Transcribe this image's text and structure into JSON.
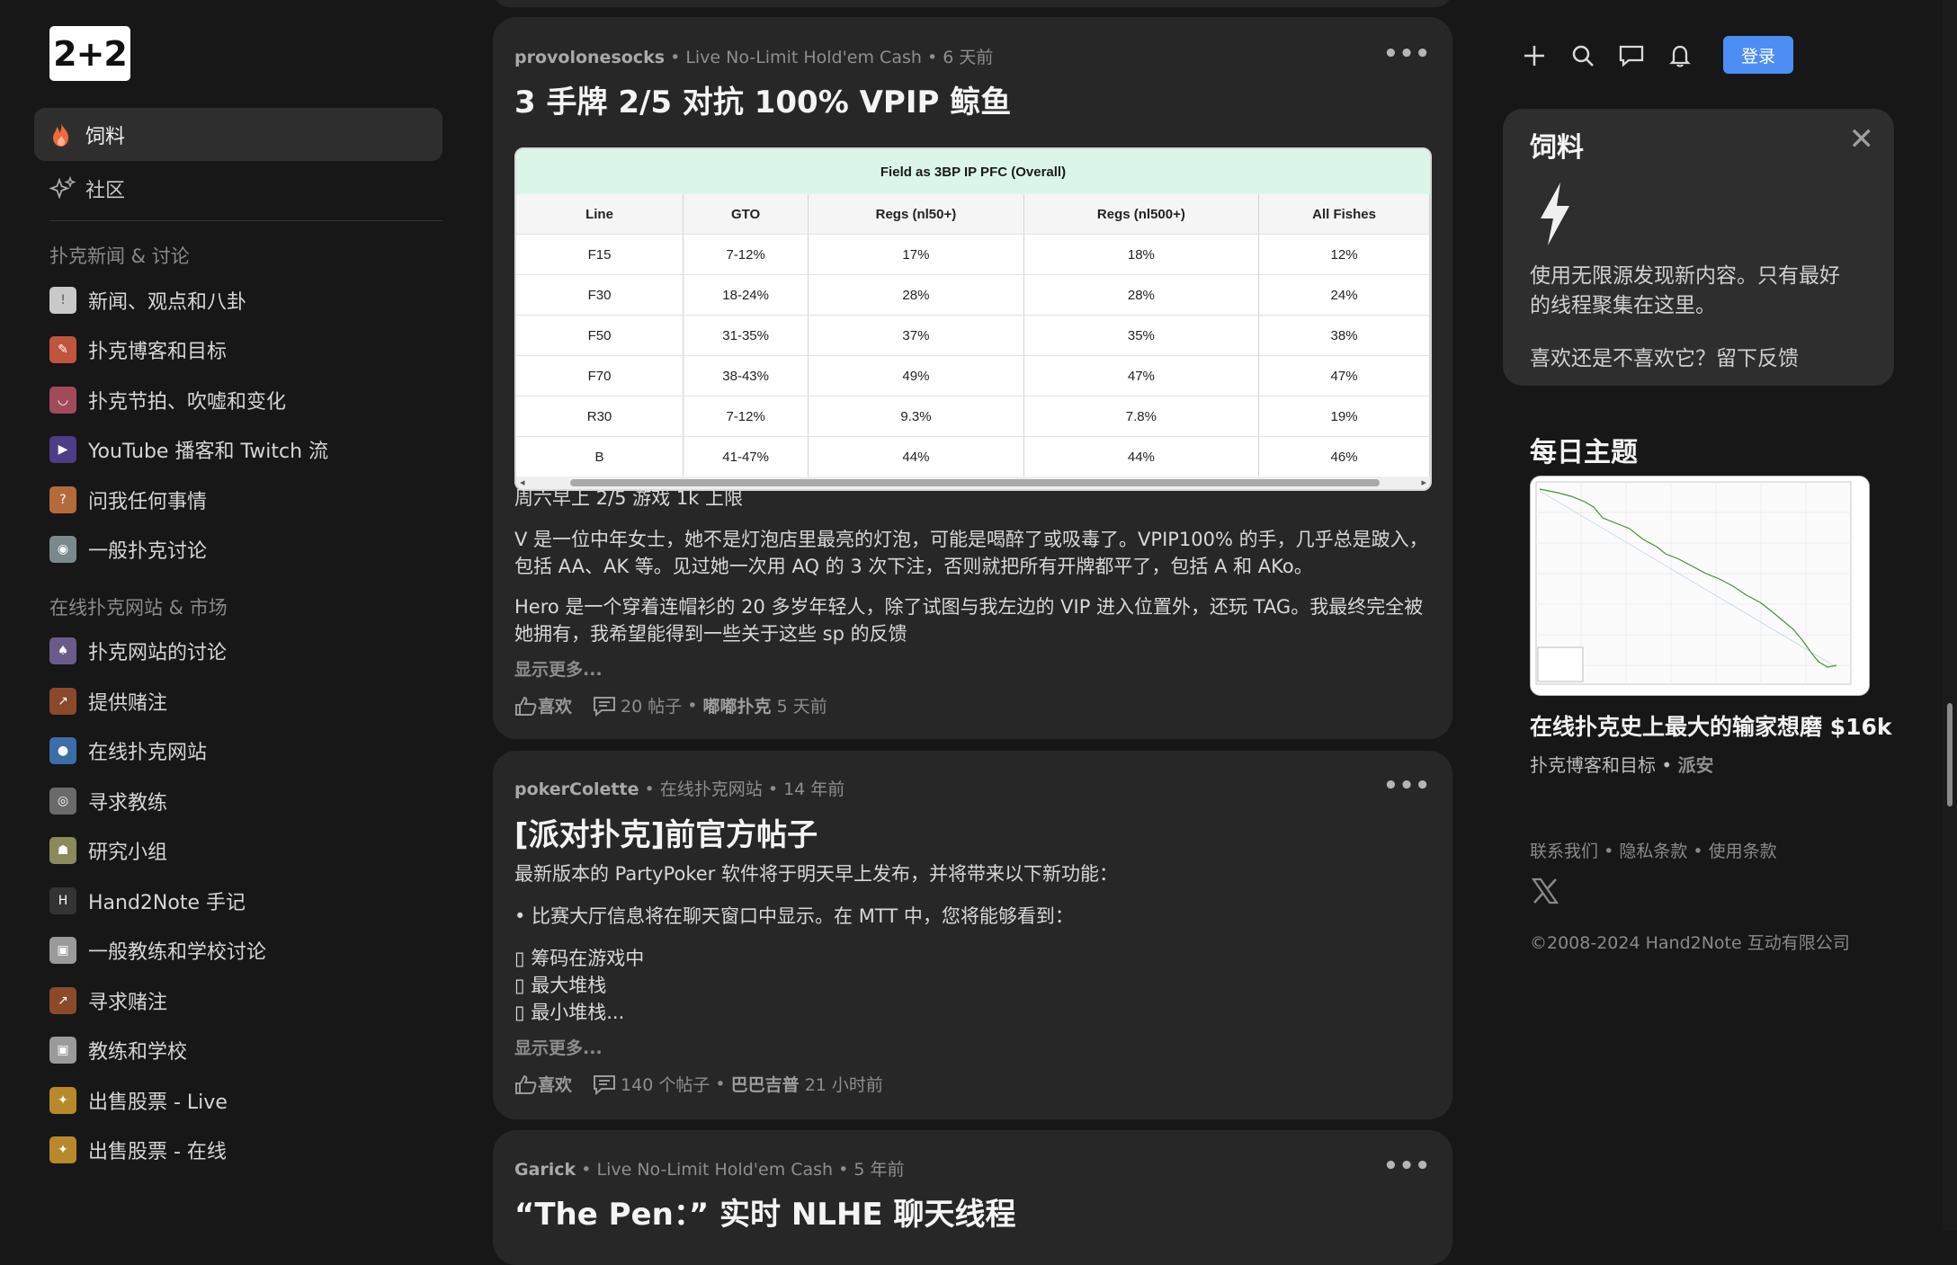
{
  "sidebar": {
    "logo": "2+2",
    "nav": [
      {
        "label": "饲料",
        "icon": "flame-icon",
        "active": true
      },
      {
        "label": "社区",
        "icon": "sparkle-icon",
        "active": false
      }
    ],
    "section1": {
      "heading": "扑克新闻 & 讨论",
      "items": [
        {
          "label": "新闻、观点和八卦",
          "color": "#c9c9c9"
        },
        {
          "label": "扑克博客和目标",
          "color": "#c0553d"
        },
        {
          "label": "扑克节拍、吹嘘和变化",
          "color": "#a14b5a"
        },
        {
          "label": "YouTube 播客和 Twitch 流",
          "color": "#4b3d86"
        },
        {
          "label": "问我任何事情",
          "color": "#b56a3a"
        },
        {
          "label": "一般扑克讨论",
          "color": "#7a8a8c"
        }
      ]
    },
    "section2": {
      "heading": "在线扑克网站 & 市场",
      "items": [
        {
          "label": "扑克网站的讨论",
          "color": "#6b5b8a"
        },
        {
          "label": "提供赌注",
          "color": "#8a4a2a"
        },
        {
          "label": "在线扑克网站",
          "color": "#3b6ea8"
        },
        {
          "label": "寻求教练",
          "color": "#6a6a6a"
        },
        {
          "label": "研究小组",
          "color": "#8a8a5a"
        },
        {
          "label": "Hand2Note 手记",
          "color": "#333333"
        },
        {
          "label": "一般教练和学校讨论",
          "color": "#9a9a9a"
        },
        {
          "label": "寻求赌注",
          "color": "#8a4a2a"
        },
        {
          "label": "教练和学校",
          "color": "#9a9a9a"
        },
        {
          "label": "出售股票 - Live",
          "color": "#b8892a"
        },
        {
          "label": "出售股票 - 在线",
          "color": "#b8892a"
        }
      ]
    }
  },
  "feed": {
    "posts": [
      {
        "author": "provolonesocks",
        "category": "Live No-Limit Hold'em Cash",
        "age": "6 天前",
        "title": "3 手牌 2/5 对抗 100% VPIP 鲸鱼",
        "table": {
          "caption": "Field as 3BP IP PFC (Overall)",
          "headers": [
            "Line",
            "GTO",
            "Regs (nl50+)",
            "Regs (nl500+)",
            "All Fishes"
          ],
          "rows": [
            [
              "F15",
              "7-12%",
              "17%",
              "18%",
              "12%"
            ],
            [
              "F30",
              "18-24%",
              "28%",
              "28%",
              "24%"
            ],
            [
              "F50",
              "31-35%",
              "37%",
              "35%",
              "38%"
            ],
            [
              "F70",
              "38-43%",
              "49%",
              "47%",
              "47%"
            ],
            [
              "R30",
              "7-12%",
              "9.3%",
              "7.8%",
              "19%"
            ],
            [
              "B",
              "41-47%",
              "44%",
              "44%",
              "46%"
            ]
          ]
        },
        "body": [
          "周六早上 2/5 游戏 1k 上限",
          "V 是一位中年女士，她不是灯泡店里最亮的灯泡，可能是喝醉了或吸毒了。VPIP100% 的手，几乎总是跛入，包括 AA、AK 等。见过她一次用 AQ 的 3 次下注，否则就把所有开牌都平了，包括 A 和 AKo。",
          "Hero 是一个穿着连帽衫的 20 多岁年轻人，除了试图与我左边的 VIP 进入位置外，还玩 TAG。我最终完全被她拥有，我希望能得到一些关于这些 sp 的反馈"
        ],
        "more": "显示更多...",
        "like": "喜欢",
        "replies": "20 帖子",
        "last_user": "嘟嘟扑克",
        "last_age": "5 天前"
      },
      {
        "author": "pokerColette",
        "category": "在线扑克网站",
        "age": "14 年前",
        "title": "[派对扑克]前官方帖子",
        "body": [
          "最新版本的 PartyPoker 软件将于明天早上发布，并将带来以下新功能：",
          "• 比赛大厅信息将在聊天窗口中显示。在 MTT 中，您将能够看到：",
          "▯ 筹码在游戏中",
          "▯ 最大堆栈",
          "▯ 最小堆栈..."
        ],
        "more": "显示更多...",
        "like": "喜欢",
        "replies": "140 个帖子",
        "last_user": "巴巴吉普",
        "last_age": "21 小时前"
      },
      {
        "author": "Garick",
        "category": "Live No-Limit Hold'em Cash",
        "age": "5 年前",
        "title": "“The Pen：” 实时 NLHE 聊天线程"
      }
    ]
  },
  "topbar": {
    "login": "登录"
  },
  "promo": {
    "title": "饲料",
    "text": "使用无限源发现新内容。只有最好的线程聚集在这里。",
    "feedback": "喜欢还是不喜欢它？留下反馈"
  },
  "daily": {
    "heading": "每日主题",
    "title": "在线扑克史上最大的输家想磨 $16k",
    "subforum": "扑克博客和目标",
    "author": "派安"
  },
  "footer": {
    "links": [
      "联系我们",
      "隐私条款",
      "使用条款"
    ],
    "copyright": "©2008-2024 Hand2Note 互动有限公司"
  },
  "colors": {
    "background": "#171717",
    "card": "#272727",
    "accent": "#4d8ef5",
    "flame": "#ee6a3c"
  }
}
